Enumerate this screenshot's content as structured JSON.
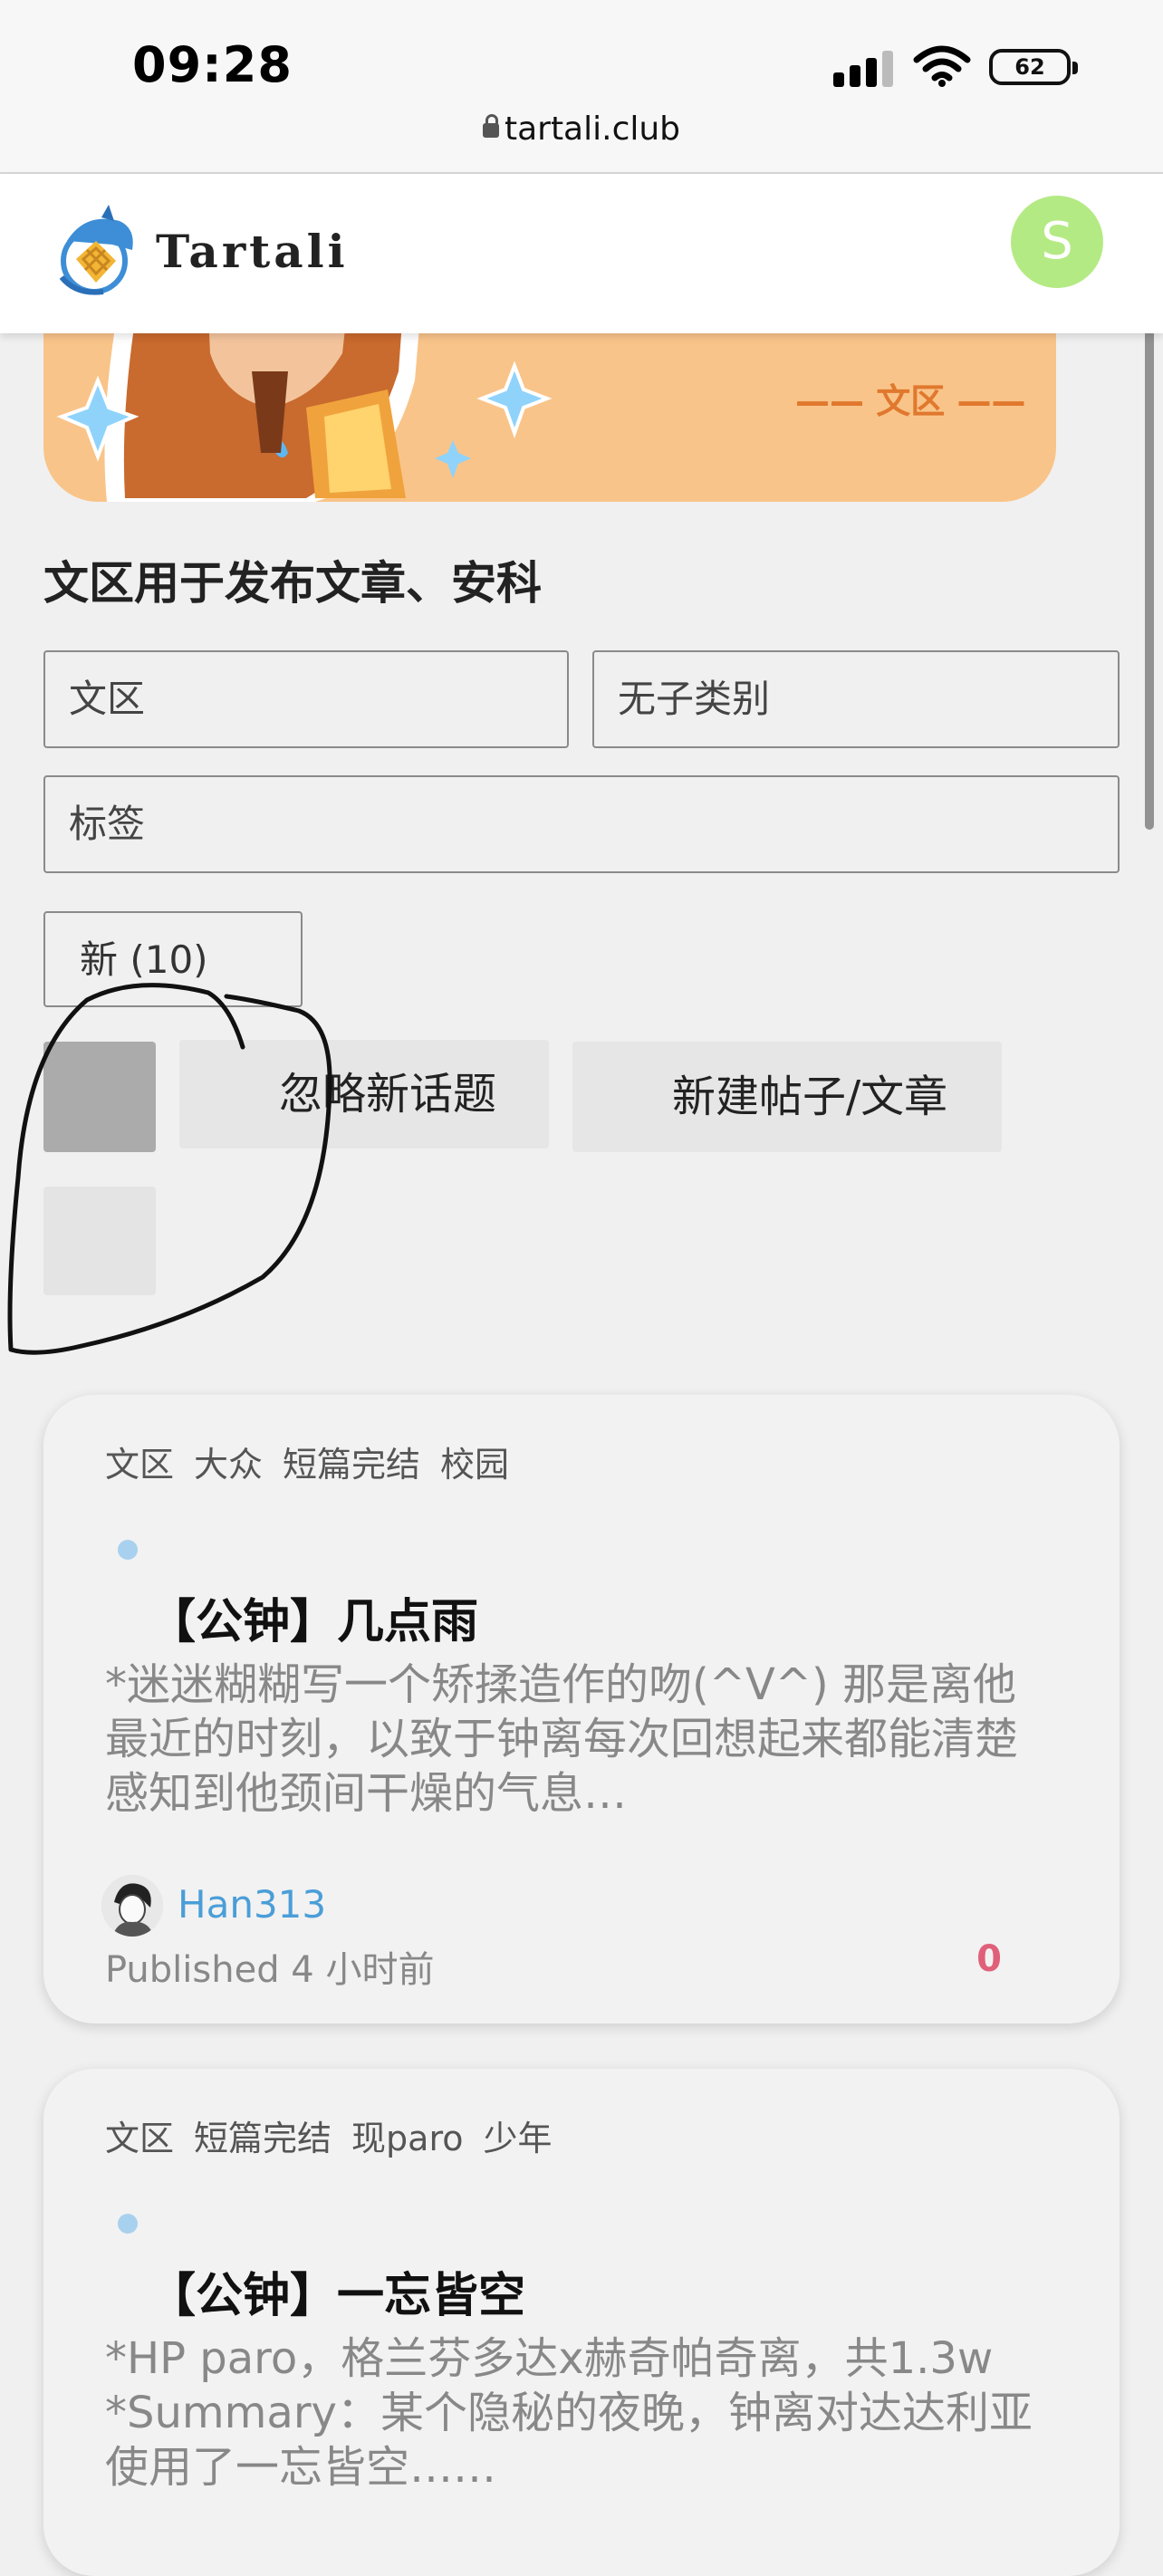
{
  "status_bar": {
    "time": "09:28",
    "battery": "62",
    "url": "tartali.club"
  },
  "header": {
    "site_name": "Tartali",
    "avatar_letter": "S"
  },
  "banner": {
    "subtitle": "—— 文区 ——"
  },
  "category": {
    "description": "文区用于发布文章、安科"
  },
  "filters": {
    "category_value": "文区",
    "subcategory_value": "无子类别",
    "tags_placeholder": "标签"
  },
  "sort": {
    "label": "新 (10)"
  },
  "actions": {
    "dismiss_label": "忽略新话题",
    "new_post_label": "新建帖子/文章"
  },
  "posts": [
    {
      "tags": [
        "文区",
        "大众",
        "短篇完结",
        "校园"
      ],
      "title": "【公钟】几点雨",
      "excerpt": "*迷迷糊糊写一个矫揉造作的吻(^V^) 那是离他最近的时刻，以致于钟离每次回想起来都能清楚感知到他颈间干燥的气息…",
      "author": "Han313",
      "published": "Published 4 小时前",
      "count": "0"
    },
    {
      "tags": [
        "文区",
        "短篇完结",
        "现paro",
        "少年"
      ],
      "title": "【公钟】一忘皆空",
      "excerpt": "*HP paro，格兰芬多达x赫奇帕奇离，共1.3w *Summary：某个隐秘的夜晚，钟离对达达利亚使用了一忘皆空……"
    }
  ],
  "colors": {
    "avatar_bg": "#b4ea84",
    "author_link": "#4a9ed8",
    "count": "#e0607a",
    "banner_bg": "#f9c489",
    "unread_dot": "#a8d1ef"
  },
  "icons": {
    "lock": "lock-icon",
    "logo": "tartali-logo-icon",
    "signal": "cellular-signal-icon",
    "wifi": "wifi-icon",
    "battery": "battery-icon"
  }
}
